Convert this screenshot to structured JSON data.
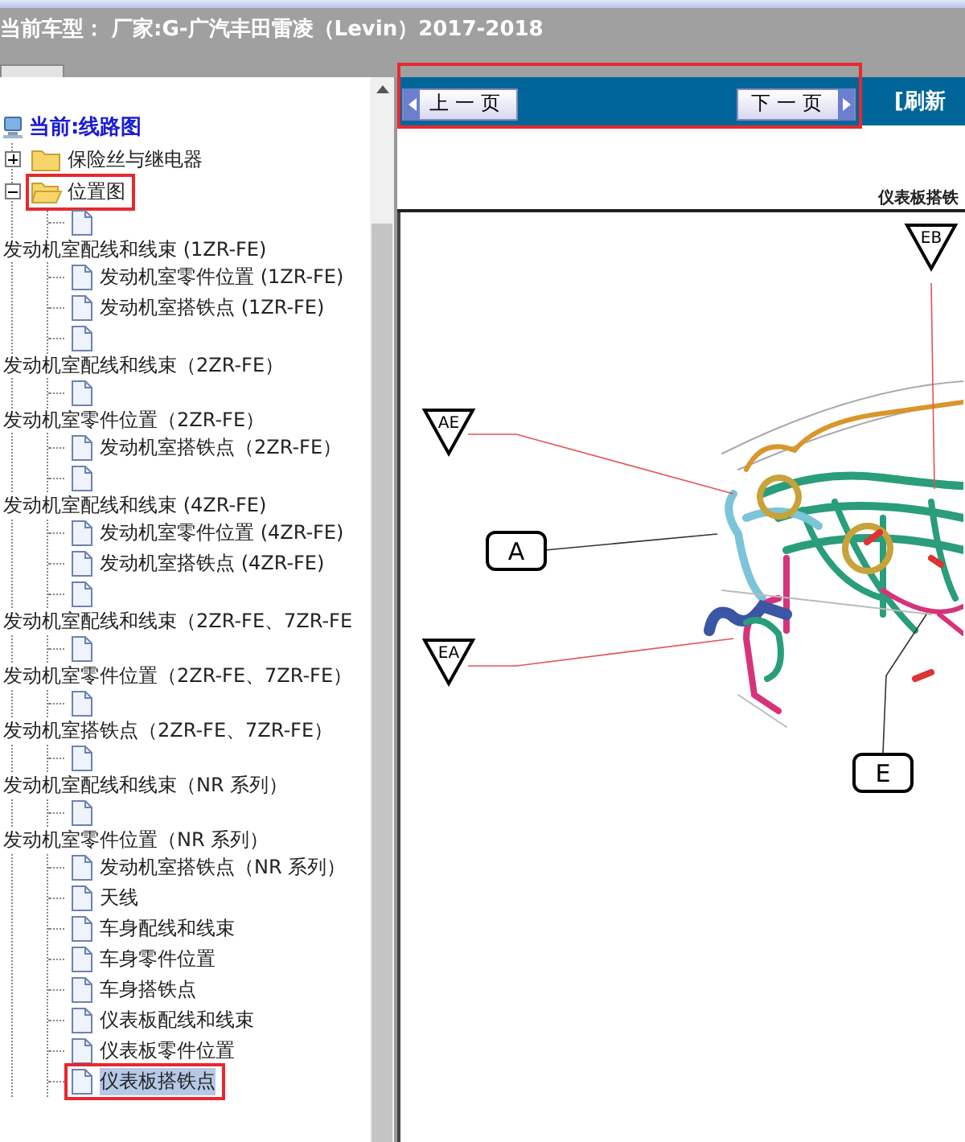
{
  "header": {
    "title": "当前车型： 厂家:G-广汽丰田雷凌（Levin）2017-2018"
  },
  "tree": {
    "root": {
      "label": "当前:线路图",
      "children": [
        {
          "label": "保险丝与继电器",
          "expanded": false,
          "annotated": false
        },
        {
          "label": "位置图",
          "expanded": true,
          "annotated": true,
          "children": [
            {
              "kind": "wrapped",
              "label": "发动机室配线和线束 (1ZR-FE)",
              "selected": false,
              "annotated": false
            },
            {
              "kind": "page",
              "label": "发动机室零件位置 (1ZR-FE)",
              "selected": false,
              "annotated": false
            },
            {
              "kind": "page",
              "label": "发动机室搭铁点 (1ZR-FE)",
              "selected": false,
              "annotated": false
            },
            {
              "kind": "wrapped",
              "label": "发动机室配线和线束（2ZR-FE）",
              "selected": false,
              "annotated": false
            },
            {
              "kind": "wrapped",
              "label": "发动机室零件位置（2ZR-FE）",
              "selected": false,
              "annotated": false
            },
            {
              "kind": "page",
              "label": "发动机室搭铁点（2ZR-FE）",
              "selected": false,
              "annotated": false
            },
            {
              "kind": "wrapped",
              "label": "发动机室配线和线束 (4ZR-FE)",
              "selected": false,
              "annotated": false
            },
            {
              "kind": "page",
              "label": "发动机室零件位置 (4ZR-FE)",
              "selected": false,
              "annotated": false
            },
            {
              "kind": "page",
              "label": "发动机室搭铁点 (4ZR-FE)",
              "selected": false,
              "annotated": false
            },
            {
              "kind": "wrapped",
              "label": "发动机室配线和线束（2ZR-FE、7ZR-FE",
              "selected": false,
              "annotated": false
            },
            {
              "kind": "wrapped",
              "label": "发动机室零件位置（2ZR-FE、7ZR-FE）",
              "selected": false,
              "annotated": false
            },
            {
              "kind": "wrapped",
              "label": "发动机室搭铁点（2ZR-FE、7ZR-FE）",
              "selected": false,
              "annotated": false
            },
            {
              "kind": "wrapped",
              "label": "发动机室配线和线束（NR 系列）",
              "selected": false,
              "annotated": false
            },
            {
              "kind": "wrapped",
              "label": "发动机室零件位置（NR 系列）",
              "selected": false,
              "annotated": false
            },
            {
              "kind": "page",
              "label": "发动机室搭铁点（NR 系列）",
              "selected": false,
              "annotated": false
            },
            {
              "kind": "page",
              "label": "天线",
              "selected": false,
              "annotated": false
            },
            {
              "kind": "page",
              "label": "车身配线和线束",
              "selected": false,
              "annotated": false
            },
            {
              "kind": "page",
              "label": "车身零件位置",
              "selected": false,
              "annotated": false
            },
            {
              "kind": "page",
              "label": "车身搭铁点",
              "selected": false,
              "annotated": false
            },
            {
              "kind": "page",
              "label": "仪表板配线和线束",
              "selected": false,
              "annotated": false
            },
            {
              "kind": "page",
              "label": "仪表板零件位置",
              "selected": false,
              "annotated": false
            },
            {
              "kind": "page",
              "label": "仪表板搭铁点",
              "selected": true,
              "annotated": true
            }
          ]
        }
      ]
    }
  },
  "toolbar": {
    "annotated": true,
    "prev_button": "上一页",
    "next_button": "下一页",
    "refresh_link": "[刷新"
  },
  "diagram": {
    "title": "仪表板搭铁",
    "ground_points": [
      {
        "label": "EB"
      },
      {
        "label": "AE"
      },
      {
        "label": "EA"
      }
    ],
    "connectors": [
      {
        "label": "A"
      },
      {
        "label": "E"
      }
    ]
  }
}
